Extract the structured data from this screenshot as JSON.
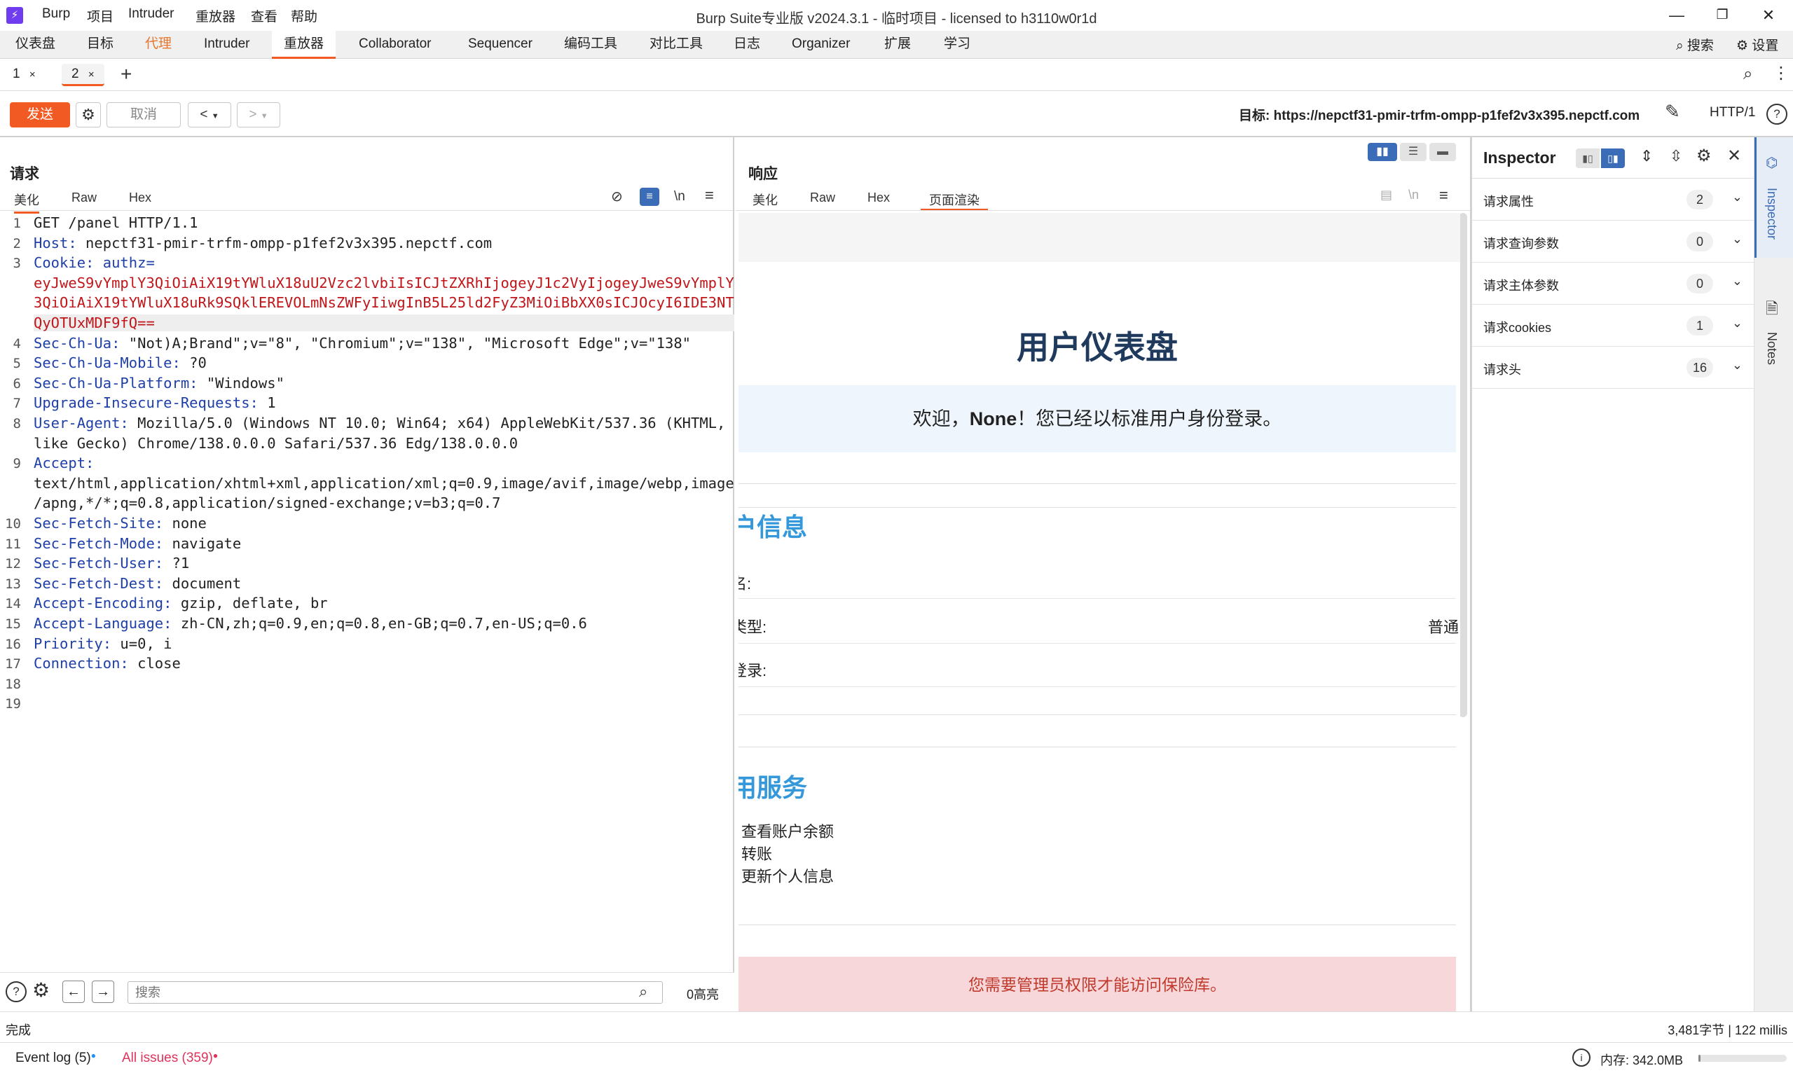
{
  "titlebar": {
    "menu": [
      "Burp",
      "项目",
      "Intruder",
      "重放器",
      "查看",
      "帮助"
    ],
    "title": "Burp Suite专业版  v2024.3.1 - 临时项目 - licensed to h3110w0r1d"
  },
  "main_tabs": [
    "仪表盘",
    "目标",
    "代理",
    "Intruder",
    "重放器",
    "Collaborator",
    "Sequencer",
    "编码工具",
    "对比工具",
    "日志",
    "Organizer",
    "扩展",
    "学习"
  ],
  "top_right": {
    "search_label": "搜索",
    "settings_label": "设置"
  },
  "sub_tabs": [
    {
      "label": "1"
    },
    {
      "label": "2"
    }
  ],
  "toolbar": {
    "send_label": "发送",
    "cancel_label": "取消",
    "target_prefix": "目标: ",
    "target_url": "https://nepctf31-pmir-trfm-ompp-p1fef2v3x395.nepctf.com",
    "http_version": "HTTP/1"
  },
  "request": {
    "title": "请求",
    "view_tabs": [
      "美化",
      "Raw",
      "Hex"
    ],
    "newline_toggle": "\\n",
    "lines": [
      {
        "n": "1",
        "text": "GET /panel HTTP/1.1"
      },
      {
        "n": "2",
        "key": "Host",
        "value": " nepctf31-pmir-trfm-ompp-p1fef2v3x395.nepctf.com"
      },
      {
        "n": "3",
        "key": "Cookie",
        "value": " authz="
      },
      {
        "n": "",
        "cookie": "eyJweS9vYmplY3QiOiAiX19tYWluX18uU2Vzc2lvbiIsICJtZXRhIjogeyJ1c2VyIjogeyJweS9vYmplY"
      },
      {
        "n": "",
        "cookie": "3QiOiAiX19tYWluX18uRk9SQklEREVOLmNsZWFyIiwgInB5L25ld2FyZ3MiOiBbXX0sICJOcyI6IDE3NT"
      },
      {
        "n": "",
        "cookie": "QyOTUxMDF9fQ=="
      },
      {
        "n": "4",
        "key": "Sec-Ch-Ua",
        "value": " \"Not)A;Brand\";v=\"8\", \"Chromium\";v=\"138\", \"Microsoft Edge\";v=\"138\""
      },
      {
        "n": "5",
        "key": "Sec-Ch-Ua-Mobile",
        "value": " ?0"
      },
      {
        "n": "6",
        "key": "Sec-Ch-Ua-Platform",
        "value": " \"Windows\""
      },
      {
        "n": "7",
        "key": "Upgrade-Insecure-Requests",
        "value": " 1"
      },
      {
        "n": "8",
        "key": "User-Agent",
        "value": " Mozilla/5.0 (Windows NT 10.0; Win64; x64) AppleWebKit/537.36 (KHTML,"
      },
      {
        "n": "",
        "text": "like Gecko) Chrome/138.0.0.0 Safari/537.36 Edg/138.0.0.0"
      },
      {
        "n": "9",
        "key": "Accept",
        "value": ""
      },
      {
        "n": "",
        "text": "text/html,application/xhtml+xml,application/xml;q=0.9,image/avif,image/webp,image"
      },
      {
        "n": "",
        "text": "/apng,*/*;q=0.8,application/signed-exchange;v=b3;q=0.7"
      },
      {
        "n": "10",
        "key": "Sec-Fetch-Site",
        "value": " none"
      },
      {
        "n": "11",
        "key": "Sec-Fetch-Mode",
        "value": " navigate"
      },
      {
        "n": "12",
        "key": "Sec-Fetch-User",
        "value": " ?1"
      },
      {
        "n": "13",
        "key": "Sec-Fetch-Dest",
        "value": " document"
      },
      {
        "n": "14",
        "key": "Accept-Encoding",
        "value": " gzip, deflate, br"
      },
      {
        "n": "15",
        "key": "Accept-Language",
        "value": " zh-CN,zh;q=0.9,en;q=0.8,en-GB;q=0.7,en-US;q=0.6"
      },
      {
        "n": "16",
        "key": "Priority",
        "value": " u=0, i"
      },
      {
        "n": "17",
        "key": "Connection",
        "value": " close"
      },
      {
        "n": "18",
        "text": ""
      },
      {
        "n": "19",
        "text": ""
      }
    ],
    "search_placeholder": "搜索",
    "highlights": "0高亮"
  },
  "response": {
    "title": "响应",
    "view_tabs": [
      "美化",
      "Raw",
      "Hex",
      "页面渲染"
    ],
    "rendered": {
      "heading": "用户仪表盘",
      "welcome_prefix": "欢迎，",
      "welcome_name": "None",
      "welcome_suffix": "！您已经以标准用户身份登录。",
      "section1": "户信息",
      "field1": "名:",
      "field2": "类型:",
      "field2_value": "普通",
      "field3": "登录:",
      "section2": "用服务",
      "services": [
        "查看账户余额",
        "转账",
        "更新个人信息"
      ],
      "alert": "您需要管理员权限才能访问保险库。"
    }
  },
  "inspector": {
    "title": "Inspector",
    "rows": [
      {
        "label": "请求属性",
        "count": "2"
      },
      {
        "label": "请求查询参数",
        "count": "0"
      },
      {
        "label": "请求主体参数",
        "count": "0"
      },
      {
        "label": "请求cookies",
        "count": "1"
      },
      {
        "label": "请求头",
        "count": "16"
      }
    ],
    "side_tabs": [
      "Inspector",
      "Notes"
    ]
  },
  "status": {
    "left": "完成",
    "right": "3,481字节 | 122 millis"
  },
  "footer": {
    "event_log": "Event log (5)",
    "all_issues": "All issues (359)",
    "memory": "内存: 342.0MB"
  },
  "colors": {
    "accent": "#f15a22",
    "header_key": "#1e3fa8",
    "cookie": "#c0161a",
    "render_heading": "#1f3a5c",
    "render_section": "#3498db",
    "alert_bg": "#f7d7da",
    "alert_text": "#c0392b"
  }
}
